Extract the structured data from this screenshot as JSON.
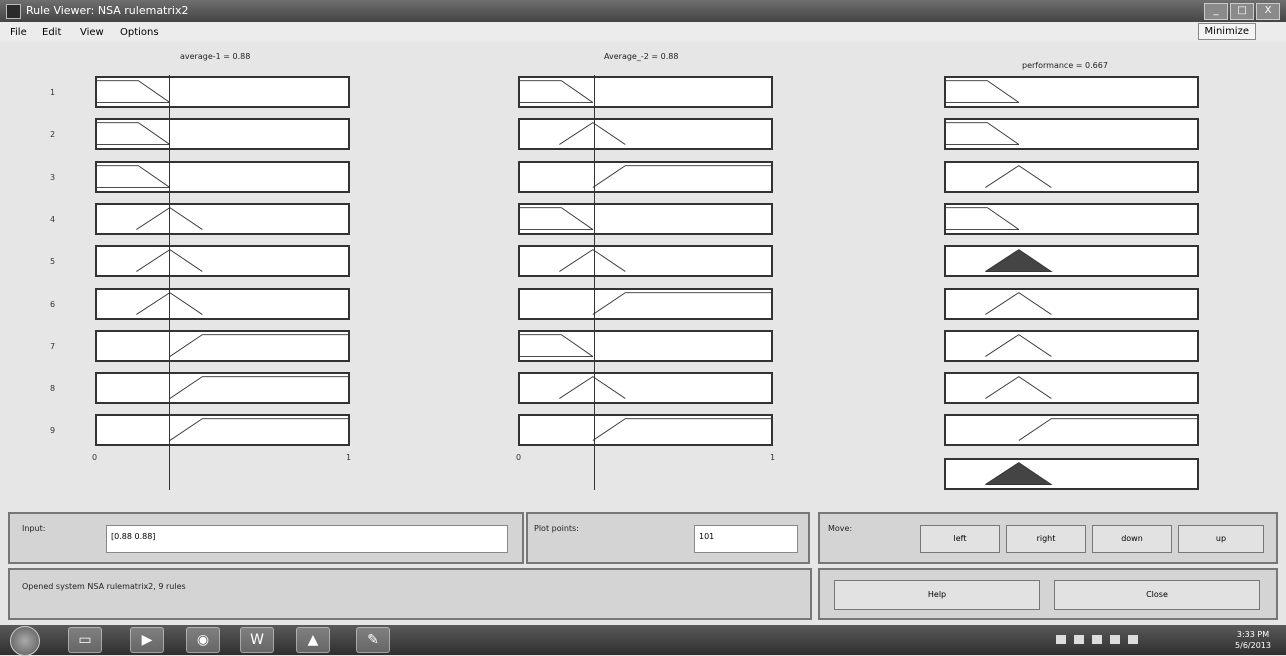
{
  "window": {
    "title": "Rule Viewer: NSA rulematrix2",
    "minimize_label": "_",
    "maximize_label": "□",
    "close_label": "X"
  },
  "menu": {
    "items": [
      "File",
      "Edit",
      "View",
      "Options"
    ],
    "right_button": "Minimize"
  },
  "input_vars": [
    {
      "header": "average-1 = 0.88",
      "axis_min": "0",
      "axis_max": "1",
      "cursor_fraction": 0.29,
      "rows": [
        "zl",
        "zl",
        "zl",
        "tri",
        "tri",
        "tri",
        "zr",
        "zr",
        "zr"
      ]
    },
    {
      "header": "Average_-2 = 0.88",
      "axis_min": "0",
      "axis_max": "1",
      "cursor_fraction": 0.29,
      "rows": [
        "zl",
        "tri",
        "zr",
        "zl",
        "tri",
        "zr",
        "zl",
        "tri",
        "zr"
      ]
    }
  ],
  "output_var": {
    "header": "performance = 0.667",
    "rows": [
      "zl",
      "zl",
      "tri",
      "zl",
      "filled",
      "tri",
      "tri",
      "tri",
      "zr"
    ],
    "aggregate": "filled"
  },
  "rule_numbers": [
    "1",
    "2",
    "3",
    "4",
    "5",
    "6",
    "7",
    "8",
    "9"
  ],
  "bottom": {
    "input_label": "Input:",
    "input_value": "[0.88 0.88]",
    "plot_points_label": "Plot points:",
    "plot_points_value": "101",
    "move_label": "Move:",
    "move_buttons": [
      "left",
      "right",
      "down",
      "up"
    ],
    "status_text": "Opened system NSA rulematrix2, 9 rules",
    "help_label": "Help",
    "close_label": "Close"
  },
  "taskbar": {
    "apps": [
      "folder-icon",
      "media-player-icon",
      "firefox-icon",
      "word-icon",
      "matlab-icon",
      "paint-icon"
    ],
    "word_glyph": "W",
    "time": "3:33 PM",
    "date": "5/6/2013"
  }
}
